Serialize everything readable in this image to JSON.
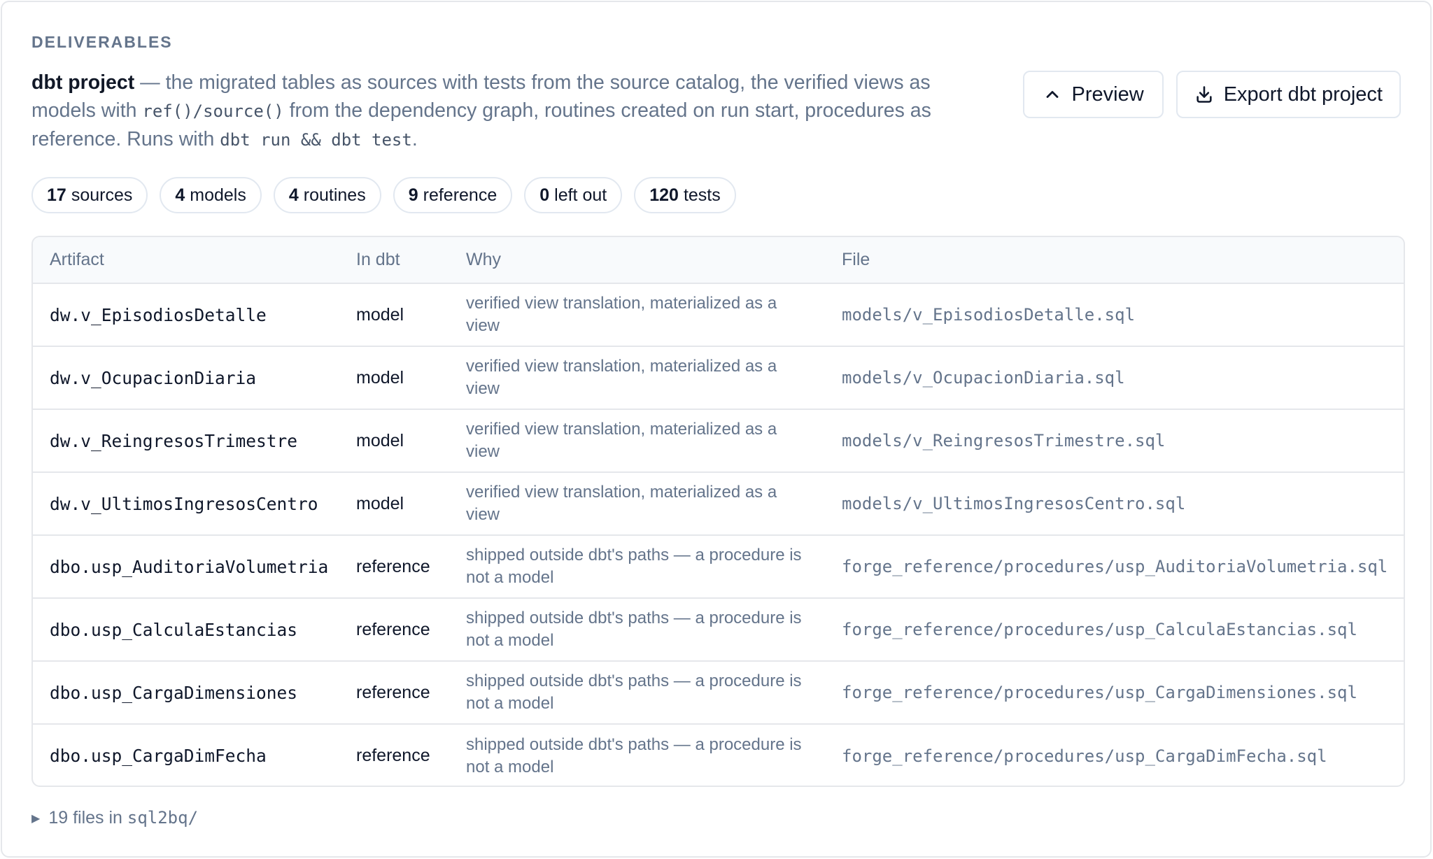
{
  "section_label": "DELIVERABLES",
  "description": {
    "lead": "dbt project",
    "part1": " — the migrated tables as sources with tests from the source catalog, the verified views as models with ",
    "code1": "ref()/source()",
    "part2": " from the dependency graph, routines created on run start, procedures as reference. Runs with ",
    "code2": "dbt run && dbt test",
    "part3": "."
  },
  "actions": {
    "preview_label": "Preview",
    "preview_icon": "chevron-up-icon",
    "export_label": "Export dbt project",
    "export_icon": "download-icon"
  },
  "pills": [
    {
      "count": "17",
      "label": "sources"
    },
    {
      "count": "4",
      "label": "models"
    },
    {
      "count": "4",
      "label": "routines"
    },
    {
      "count": "9",
      "label": "reference"
    },
    {
      "count": "0",
      "label": "left out"
    },
    {
      "count": "120",
      "label": "tests"
    }
  ],
  "table": {
    "headers": {
      "artifact": "Artifact",
      "in_dbt": "In dbt",
      "why": "Why",
      "file": "File"
    },
    "rows": [
      {
        "artifact": "dw.v_EpisodiosDetalle",
        "in_dbt": "model",
        "why": "verified view translation, materialized as a view",
        "file": "models/v_EpisodiosDetalle.sql"
      },
      {
        "artifact": "dw.v_OcupacionDiaria",
        "in_dbt": "model",
        "why": "verified view translation, materialized as a view",
        "file": "models/v_OcupacionDiaria.sql"
      },
      {
        "artifact": "dw.v_ReingresosTrimestre",
        "in_dbt": "model",
        "why": "verified view translation, materialized as a view",
        "file": "models/v_ReingresosTrimestre.sql"
      },
      {
        "artifact": "dw.v_UltimosIngresosCentro",
        "in_dbt": "model",
        "why": "verified view translation, materialized as a view",
        "file": "models/v_UltimosIngresosCentro.sql"
      },
      {
        "artifact": "dbo.usp_AuditoriaVolumetria",
        "in_dbt": "reference",
        "why": "shipped outside dbt's paths — a procedure is not a model",
        "file": "forge_reference/procedures/usp_AuditoriaVolumetria.sql"
      },
      {
        "artifact": "dbo.usp_CalculaEstancias",
        "in_dbt": "reference",
        "why": "shipped outside dbt's paths — a procedure is not a model",
        "file": "forge_reference/procedures/usp_CalculaEstancias.sql"
      },
      {
        "artifact": "dbo.usp_CargaDimensiones",
        "in_dbt": "reference",
        "why": "shipped outside dbt's paths — a procedure is not a model",
        "file": "forge_reference/procedures/usp_CargaDimensiones.sql"
      },
      {
        "artifact": "dbo.usp_CargaDimFecha",
        "in_dbt": "reference",
        "why": "shipped outside dbt's paths — a procedure is not a model",
        "file": "forge_reference/procedures/usp_CargaDimFecha.sql"
      }
    ]
  },
  "files_toggle": {
    "icon": "triangle-right-icon",
    "text": "19 files in ",
    "path": "sql2bq/"
  }
}
